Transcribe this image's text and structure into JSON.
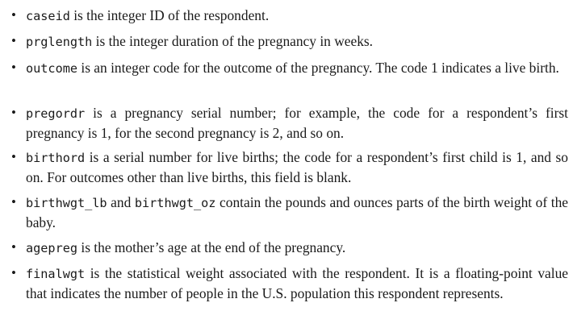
{
  "items": [
    {
      "code": "caseid",
      "text": " is the integer ID of the respondent."
    },
    {
      "code": "prglength",
      "text": " is the integer duration of the pregnancy in weeks."
    },
    {
      "code": "outcome",
      "text": " is an integer code for the outcome of the pregnancy. The code 1 indicates a live birth."
    },
    {
      "code": "pregordr",
      "text": " is a pregnancy serial number; for example, the code for a respondent’s first pregnancy is 1, for the second pregnancy is 2, and so on."
    },
    {
      "code": "birthord",
      "text": " is a serial number for live births; the code for a respondent’s first child is 1, and so on. For outcomes other than live births, this field is blank."
    },
    {
      "code": "birthwgt_lb",
      "middle": " and ",
      "code2": "birthwgt_oz",
      "text": " contain the pounds and ounces parts of the birth weight of the baby."
    },
    {
      "code": "agepreg",
      "text": " is the mother’s age at the end of the pregnancy."
    },
    {
      "code": "finalwgt",
      "text": " is the statistical weight associated with the respondent. It is a floating-point value that indicates the number of people in the U.S. population this respondent represents."
    }
  ]
}
